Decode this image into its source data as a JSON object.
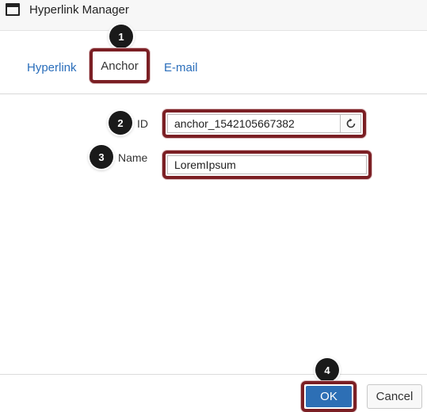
{
  "window": {
    "title": "Hyperlink Manager",
    "icon": "window-icon"
  },
  "tabs": [
    {
      "label": "Hyperlink",
      "active": false
    },
    {
      "label": "Anchor",
      "active": true
    },
    {
      "label": "E-mail",
      "active": false
    }
  ],
  "form": {
    "id_label": "ID",
    "id_value": "anchor_1542105667382",
    "name_label": "Name",
    "name_value": "LoremIpsum",
    "reset_icon": "refresh-icon"
  },
  "footer": {
    "ok_label": "OK",
    "cancel_label": "Cancel"
  },
  "callouts": [
    "1",
    "2",
    "3",
    "4"
  ],
  "colors": {
    "highlight": "#7b1f24",
    "link": "#2a6ebb",
    "primary_button": "#2d6fb5",
    "marker": "#1a1a1a"
  }
}
